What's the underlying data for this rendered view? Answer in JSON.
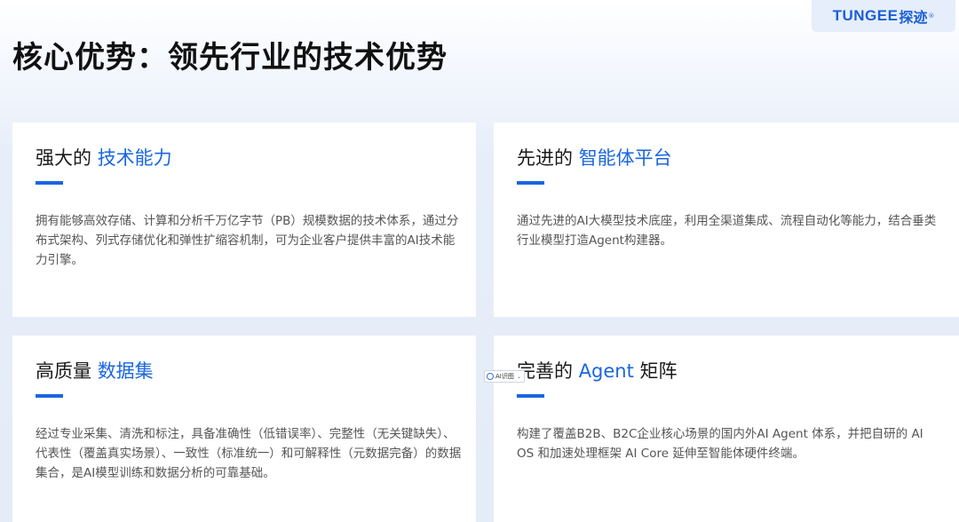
{
  "brand": {
    "latin": "TUNGEE",
    "chinese": "探迹",
    "reg": "®"
  },
  "page_title": "核心优势：领先行业的技术优势",
  "cards": [
    {
      "title_prefix": "强大的 ",
      "title_highlight": "技术能力",
      "title_suffix": "",
      "description": "拥有能够高效存储、计算和分析千万亿字节（PB）规模数据的技术体系，通过分布式架构、列式存储优化和弹性扩缩容机制，可为企业客户提供丰富的AI技术能力引擎。"
    },
    {
      "title_prefix": "先进的 ",
      "title_highlight": "智能体平台",
      "title_suffix": "",
      "description": "通过先进的AI大模型技术底座，利用全渠道集成、流程自动化等能力，结合垂类行业模型打造Agent构建器。"
    },
    {
      "title_prefix": "高质量 ",
      "title_highlight": "数据集",
      "title_suffix": "",
      "description": "经过专业采集、清洗和标注，具备准确性（低错误率）、完整性（无关键缺失）、代表性（覆盖真实场景）、一致性（标准统一）和可解释性（元数据完备）的数据集合，是AI模型训练和数据分析的可靠基础。"
    },
    {
      "title_prefix": "完善的 ",
      "title_highlight": "Agent",
      "title_suffix": " 矩阵",
      "description": "构建了覆盖B2B、B2C企业核心场景的国内外AI Agent 体系，并把自研的 AI OS 和加速处理框架 AI Core 延伸至智能体硬件终端。"
    }
  ],
  "ai_chip": {
    "label": "AI识图",
    "caret": "⌄"
  },
  "colors": {
    "accent": "#1a66e0",
    "title_text": "#111111",
    "desc_text": "#555555"
  }
}
